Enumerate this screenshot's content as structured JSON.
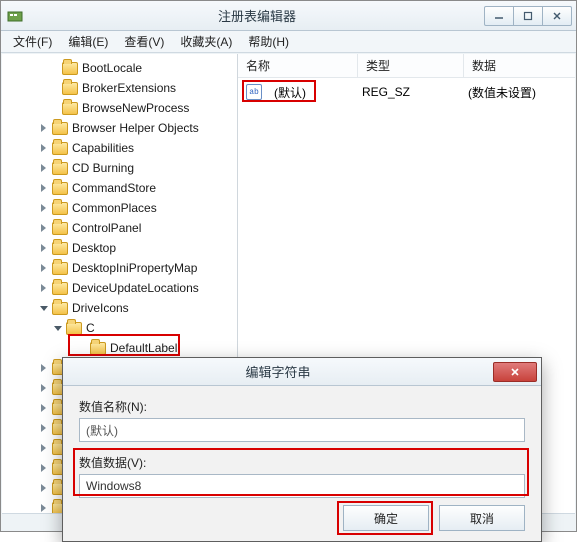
{
  "window": {
    "title": "注册表编辑器",
    "controls": {
      "min": "—",
      "max": "▢",
      "close": "✕"
    }
  },
  "menu": {
    "file": "文件(F)",
    "edit": "编辑(E)",
    "view": "查看(V)",
    "fav": "收藏夹(A)",
    "help": "帮助(H)"
  },
  "tree": {
    "items": [
      {
        "indent": 46,
        "exp": "none",
        "label": "BootLocale"
      },
      {
        "indent": 46,
        "exp": "none",
        "label": "BrokerExtensions"
      },
      {
        "indent": 46,
        "exp": "none",
        "label": "BrowseNewProcess"
      },
      {
        "indent": 36,
        "exp": "right",
        "label": "Browser Helper Objects"
      },
      {
        "indent": 36,
        "exp": "right",
        "label": "Capabilities"
      },
      {
        "indent": 36,
        "exp": "right",
        "label": "CD Burning"
      },
      {
        "indent": 36,
        "exp": "right",
        "label": "CommandStore"
      },
      {
        "indent": 36,
        "exp": "right",
        "label": "CommonPlaces"
      },
      {
        "indent": 36,
        "exp": "right",
        "label": "ControlPanel"
      },
      {
        "indent": 36,
        "exp": "right",
        "label": "Desktop"
      },
      {
        "indent": 36,
        "exp": "right",
        "label": "DesktopIniPropertyMap"
      },
      {
        "indent": 36,
        "exp": "right",
        "label": "DeviceUpdateLocations"
      },
      {
        "indent": 36,
        "exp": "down",
        "label": "DriveIcons"
      },
      {
        "indent": 50,
        "exp": "down",
        "label": "C"
      },
      {
        "indent": 74,
        "exp": "none",
        "label": "DefaultLabel"
      },
      {
        "indent": 36,
        "exp": "right",
        "label": ""
      },
      {
        "indent": 36,
        "exp": "right",
        "label": ""
      },
      {
        "indent": 36,
        "exp": "right",
        "label": ""
      },
      {
        "indent": 36,
        "exp": "right",
        "label": ""
      },
      {
        "indent": 36,
        "exp": "right",
        "label": ""
      },
      {
        "indent": 36,
        "exp": "right",
        "label": ""
      },
      {
        "indent": 36,
        "exp": "right",
        "label": ""
      },
      {
        "indent": 36,
        "exp": "right",
        "label": ""
      }
    ]
  },
  "list": {
    "columns": {
      "name": "名称",
      "type": "类型",
      "data": "数据"
    },
    "row0": {
      "icon_text": "ab",
      "name": "(默认)",
      "type": "REG_SZ",
      "data": "(数值未设置)"
    }
  },
  "dialog": {
    "title": "编辑字符串",
    "name_label": "数值名称(N):",
    "name_value": "(默认)",
    "data_label": "数值数据(V):",
    "data_value": "Windows8",
    "ok": "确定",
    "cancel": "取消"
  }
}
